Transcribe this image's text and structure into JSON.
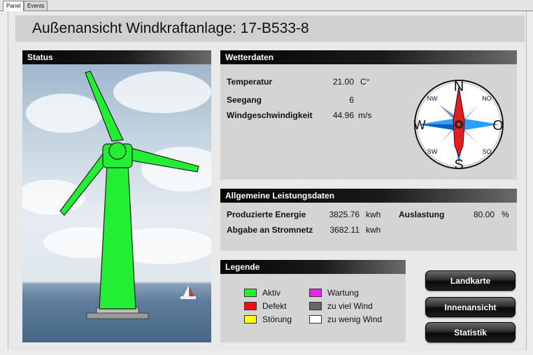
{
  "tabs": [
    {
      "label": "Panel",
      "active": true
    },
    {
      "label": "Events",
      "active": false
    }
  ],
  "title": "Außenansicht Windkraftanlage: 17-B533-8",
  "status": {
    "heading": "Status",
    "turbine_color": "#22ee33"
  },
  "wetterdaten": {
    "heading": "Wetterdaten",
    "rows": [
      {
        "label": "Temperatur",
        "value": "21.00",
        "unit": "C°"
      },
      {
        "label": "Seegang",
        "value": "6",
        "unit": ""
      },
      {
        "label": "Windgeschwindigkeit",
        "value": "44.96",
        "unit": "m/s"
      }
    ],
    "compass": {
      "north": "N",
      "south": "S",
      "west": "W",
      "east": "O",
      "nw": "NW",
      "no": "NO",
      "sw": "SW",
      "so": "SO",
      "needle_color": "#e02020"
    }
  },
  "leistung": {
    "heading": "Allgemeine Leistungsdaten",
    "produced": {
      "label": "Produzierte Energie",
      "value": "3825.76",
      "unit": "kwh"
    },
    "auslastung": {
      "label": "Auslastung",
      "value": "80.00",
      "unit": "%"
    },
    "abgabe": {
      "label": "Abgabe an Stromnetz",
      "value": "3682.11",
      "unit": "kwh"
    }
  },
  "legende": {
    "heading": "Legende",
    "items": [
      {
        "label": "Aktiv",
        "color": "#22ee33"
      },
      {
        "label": "Defekt",
        "color": "#ee1111"
      },
      {
        "label": "Störung",
        "color": "#ffff22"
      },
      {
        "label": "Wartung",
        "color": "#ee22ee"
      },
      {
        "label": "zu viel Wind",
        "color": "#666666"
      },
      {
        "label": "zu wenig Wind",
        "color": "#ffffff"
      }
    ]
  },
  "buttons": {
    "landkarte": "Landkarte",
    "innenansicht": "Innenansicht",
    "statistik": "Statistik"
  }
}
